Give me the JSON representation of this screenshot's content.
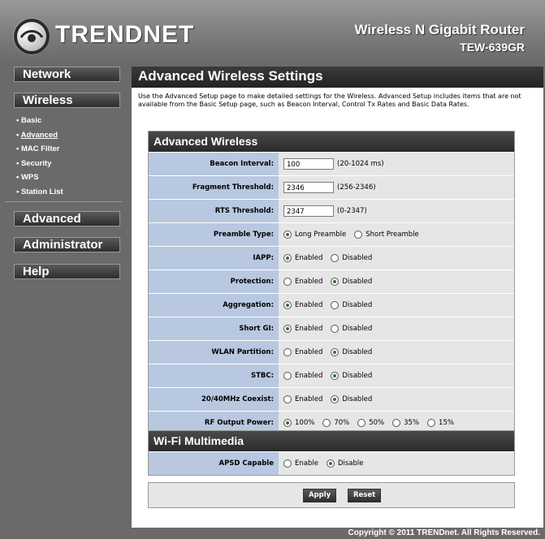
{
  "header": {
    "brand": "TRENDNET",
    "model_title": "Wireless N Gigabit Router",
    "model_number": "TEW-639GR",
    "logo_icon": "trendnet-eye-logo"
  },
  "sidebar": {
    "network": "Network",
    "wireless": "Wireless",
    "wireless_items": [
      "Basic",
      "Advanced",
      "MAC Filter",
      "Security",
      "WPS",
      "Station List"
    ],
    "active_item": "Advanced",
    "advanced": "Advanced",
    "administrator": "Administrator",
    "help": "Help"
  },
  "main": {
    "title": "Advanced Wireless Settings",
    "description": "Use the Advanced Setup page to make detailed settings for the Wireless. Advanced Setup includes items that are not available from the Basic Setup page, such as Beacon Interval, Control Tx Rates and Basic Data Rates.",
    "advanced_section": {
      "heading": "Advanced Wireless",
      "beacon_label": "Beacon Interval:",
      "beacon_value": "100",
      "beacon_hint": "(20-1024 ms)",
      "fragment_label": "Fragment Threshold:",
      "fragment_value": "2346",
      "fragment_hint": "(256-2346)",
      "rts_label": "RTS Threshold:",
      "rts_value": "2347",
      "rts_hint": "(0-2347)",
      "preamble_label": "Preamble Type:",
      "preamble_long": "Long Preamble",
      "preamble_short": "Short Preamble",
      "iapp_label": "IAPP:",
      "protection_label": "Protection:",
      "aggregation_label": "Aggregation:",
      "shortgi_label": "Short GI:",
      "wlan_label": "WLAN Partition:",
      "stbc_label": "STBC:",
      "coexist_label": "20/40MHz Coexist:",
      "enabled": "Enabled",
      "disabled": "Disabled",
      "rf_label": "RF Output Power:",
      "rf_options": [
        "100%",
        "70%",
        "50%",
        "35%",
        "15%"
      ]
    },
    "wmm_section": {
      "heading": "Wi-Fi Multimedia",
      "apsd_label": "APSD Capable",
      "enable": "Enable",
      "disable": "Disable"
    },
    "apply": "Apply",
    "reset": "Reset"
  },
  "footer": {
    "copyright": "Copyright © 2011 TRENDnet. All Rights Reserved."
  },
  "colors": {
    "label_bg": "#b8c8e0",
    "value_bg": "#e6e6e6",
    "header_bar": "#2a2a2a",
    "page_bg": "#6a6a6a"
  }
}
